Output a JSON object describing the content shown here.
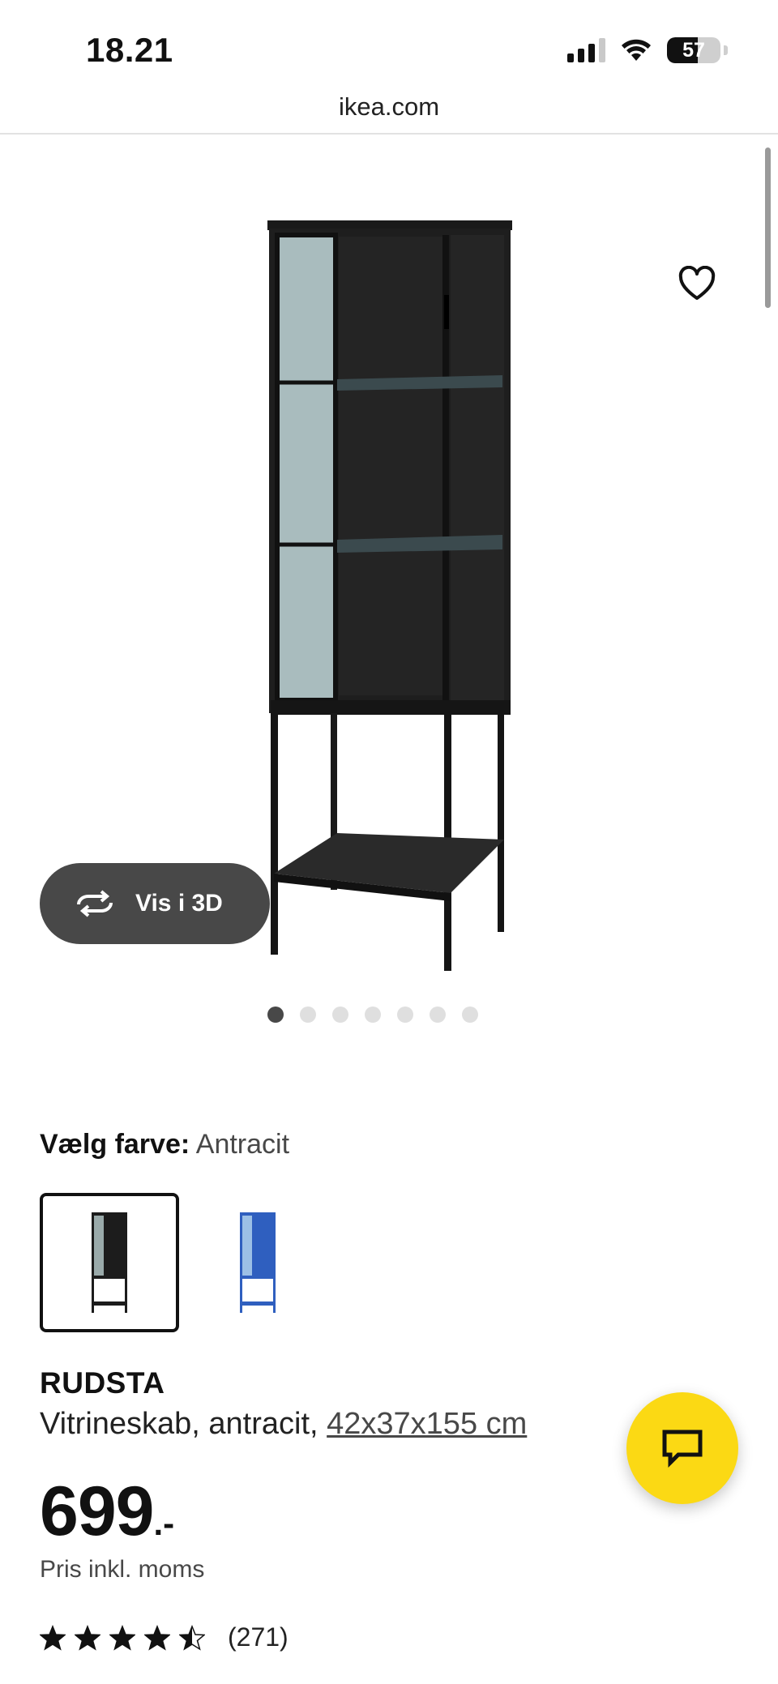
{
  "status_bar": {
    "time": "18.21",
    "battery": "57",
    "battery_level": 0.57,
    "icons": [
      "cellular-signal-icon",
      "wifi-icon",
      "battery-icon"
    ]
  },
  "browser": {
    "url": "ikea.com"
  },
  "gallery": {
    "view_3d_label": "Vis i 3D",
    "image_count": 7,
    "active_index": 0,
    "icons": [
      "heart-icon",
      "rotate-3d-icon"
    ]
  },
  "color_select": {
    "label": "Vælg farve:",
    "value": "Antracit",
    "options": [
      {
        "name": "Antracit",
        "color": "#1c1c1c",
        "selected": true
      },
      {
        "name": "Blå",
        "color": "#2f5fbf",
        "selected": false
      }
    ]
  },
  "product": {
    "name": "RUDSTA",
    "description": "Vitrineskab, antracit, ",
    "size": "42x37x155 cm",
    "price": "699",
    "price_suffix": ".-",
    "price_note": "Pris inkl. moms",
    "rating": 4.5,
    "review_count": "(271)"
  },
  "colors": {
    "accent_yellow": "#fbd914",
    "button_dark": "#484848",
    "text": "#111111"
  }
}
